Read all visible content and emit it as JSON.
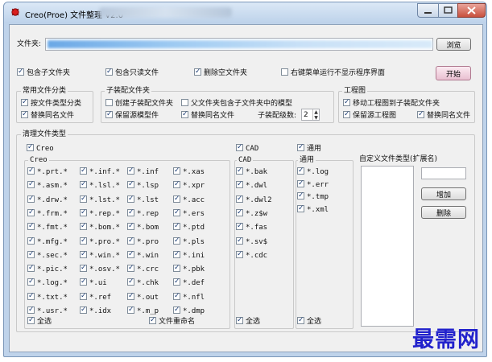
{
  "window": {
    "title": "Creo(Proe) 文件整理  V2.0",
    "colors": {
      "title_bg": "#bfd3ea",
      "client_bg": "#f0f0f0",
      "close_button": "#c8503e",
      "start_button": "#e9c0d1",
      "watermark": "#2222cc"
    }
  },
  "folder": {
    "label": "文件夹:",
    "value": "",
    "browse_label": "浏览"
  },
  "options": {
    "include_sub": {
      "label": "包含子文件夹",
      "checked": true
    },
    "include_readonly": {
      "label": "包含只读文件",
      "checked": true
    },
    "delete_empty": {
      "label": "删除空文件夹",
      "checked": true
    },
    "context_menu": {
      "label": "右键菜单运行不显示程序界面",
      "checked": false
    },
    "start_label": "开始"
  },
  "common": {
    "title": "常用文件分类",
    "by_type": {
      "label": "按文件类型分类",
      "checked": true
    },
    "replace_same": {
      "label": "替换同名文件",
      "checked": true
    }
  },
  "subasm": {
    "title": "子装配文件夹",
    "create": {
      "label": "创建子装配文件夹",
      "checked": false
    },
    "parent_contains": {
      "label": "父文件夹包含子文件夹中的模型",
      "checked": false
    },
    "keep_model": {
      "label": "保留源模型件",
      "checked": true
    },
    "replace_same": {
      "label": "替换同名文件",
      "checked": true
    },
    "level_label": "子装配级数:",
    "level_value": "2"
  },
  "drawing": {
    "title": "工程图",
    "move": {
      "label": "移动工程图到子装配文件夹",
      "checked": true
    },
    "keep_source": {
      "label": "保留源工程图",
      "checked": true
    },
    "replace_same": {
      "label": "替换同名文件",
      "checked": true
    }
  },
  "clean": {
    "title": "清理文件类型",
    "creo": {
      "toggle": {
        "label": "Creo",
        "checked": true
      },
      "header": "Creo",
      "columns": [
        [
          "*.prt.*",
          "*.asm.*",
          "*.drw.*",
          "*.frm.*",
          "*.fmt.*",
          "*.mfg.*",
          "*.sec.*",
          "*.pic.*",
          "*.log.*",
          "*.txt.*",
          "*.usr.*"
        ],
        [
          "*.inf.*",
          "*.lsl.*",
          "*.lst.*",
          "*.rep.*",
          "*.bom.*",
          "*.pro.*",
          "*.win.*",
          "*.osv.*",
          "*.ui",
          "*.ref",
          "*.idx"
        ],
        [
          "*.inf",
          "*.lsp",
          "*.lst",
          "*.rep",
          "*.bom",
          "*.pro",
          "*.win",
          "*.crc",
          "*.chk",
          "*.out",
          "*.m_p"
        ],
        [
          "*.xas",
          "*.xpr",
          "*.acc",
          "*.ers",
          "*.ptd",
          "*.pls",
          "*.ini",
          "*.pbk",
          "*.def",
          "*.nfl",
          "*.dmp"
        ]
      ],
      "select_all": {
        "label": "全选",
        "checked": true
      },
      "rename": {
        "label": "文件重命名",
        "checked": true
      }
    },
    "cad": {
      "toggle": {
        "label": "CAD",
        "checked": true
      },
      "header": "CAD",
      "items": [
        "*.bak",
        "*.dwl",
        "*.dwl2",
        "*.z$w",
        "*.fas",
        "*.sv$",
        "*.cdc"
      ],
      "select_all": {
        "label": "全选",
        "checked": true
      }
    },
    "general": {
      "toggle": {
        "label": "通用",
        "checked": true
      },
      "header": "通用",
      "items": [
        "*.log",
        "*.err",
        "*.tmp",
        "*.xml"
      ],
      "select_all": {
        "label": "全选",
        "checked": true
      }
    },
    "custom": {
      "title": "自定义文件类型(扩展名)",
      "input_value": "",
      "add_label": "增加",
      "delete_label": "删除"
    }
  },
  "watermark": "最需网"
}
